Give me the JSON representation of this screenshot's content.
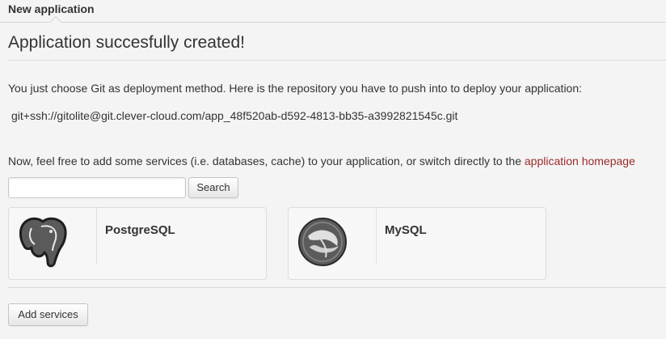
{
  "tab": {
    "label": "New application"
  },
  "page": {
    "title": "Application succesfully created!",
    "intro": "You just choose Git as deployment method. Here is the repository you have to push into to deploy your application:",
    "repository_url": "git+ssh://gitolite@git.clever-cloud.com/app_48f520ab-d592-4813-bb35-a3992821545c.git",
    "services_text": "Now, feel free to add some services (i.e. databases, cache) to your application, or switch directly to the ",
    "homepage_link": "application homepage"
  },
  "search": {
    "value": "",
    "button_label": "Search"
  },
  "services": [
    {
      "name": "PostgreSQL",
      "icon": "postgresql-elephant-icon"
    },
    {
      "name": "MySQL",
      "icon": "mysql-dolphin-icon"
    }
  ],
  "actions": {
    "add_services_label": "Add services"
  },
  "colors": {
    "link": "#9b2a2a",
    "background": "#f4f4f4"
  }
}
